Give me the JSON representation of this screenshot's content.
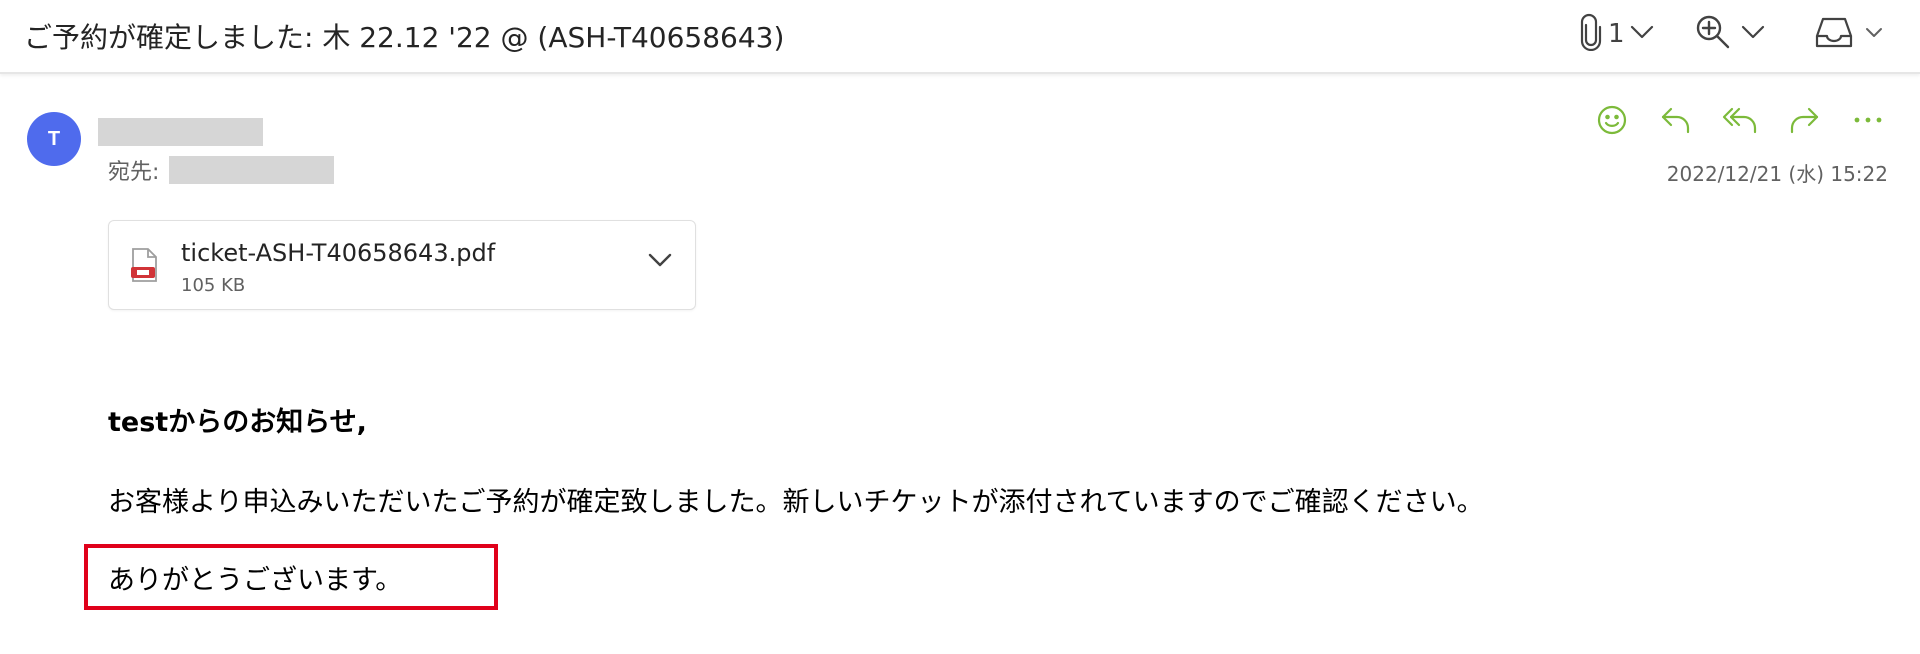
{
  "email": {
    "subject": "ご予約が確定しました: 木 22.12 '22 @ (ASH-T40658643)",
    "attachment_count": "1",
    "sender_initial": "T",
    "to_label": "宛先:",
    "date": "2022/12/21 (水) 15:22",
    "attachment": {
      "filename": "ticket-ASH-T40658643.pdf",
      "size": "105 KB"
    },
    "body": {
      "greeting": "testからのお知らせ,",
      "message": "お客様より申込みいただいたご予約が確定致しました。新しいチケットが添付されていますのでご確認ください。",
      "thanks": "ありがとうございます。"
    }
  },
  "icons": {
    "header": [
      "paperclip-icon",
      "chevron-down-icon",
      "zoom-in-icon",
      "chevron-down-icon",
      "inbox-icon",
      "chevron-down-icon"
    ],
    "actions": [
      "emoji-icon",
      "reply-icon",
      "reply-all-icon",
      "forward-icon",
      "more-icon"
    ],
    "attachment": [
      "pdf-file-icon",
      "chevron-down-icon"
    ]
  },
  "colors": {
    "avatar": "#4f6bed",
    "action_icons": "#7cba3a",
    "highlight_border": "#e0001a"
  }
}
